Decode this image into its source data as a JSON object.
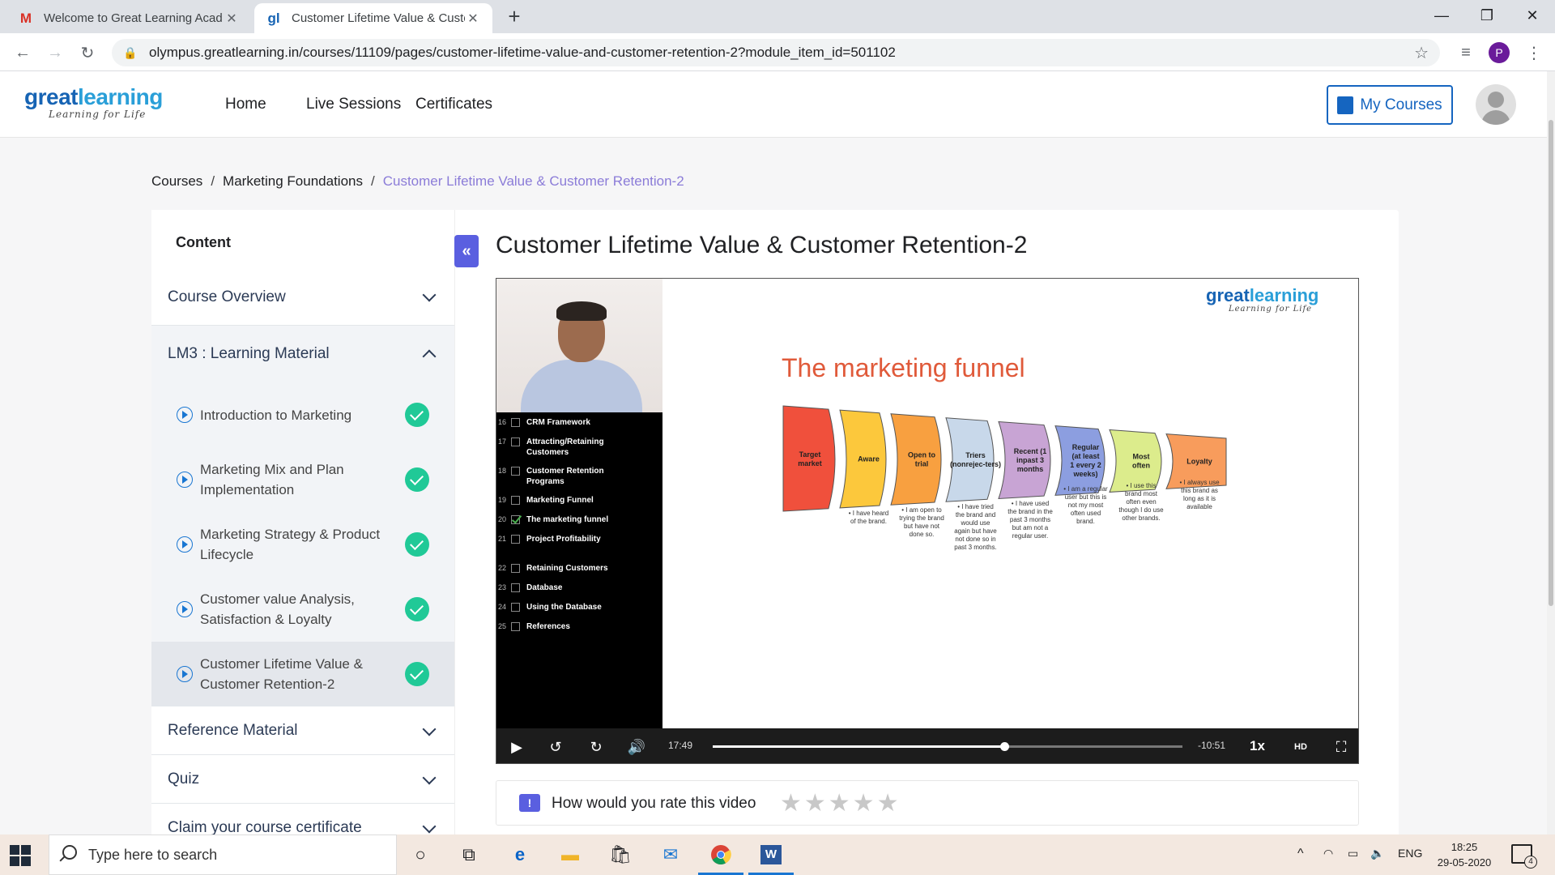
{
  "browser": {
    "tabs": [
      {
        "title": "Welcome to Great Learning Acad",
        "favicon": "gmail-icon"
      },
      {
        "title": "Customer Lifetime Value & Custo",
        "favicon": "greatlearning-icon"
      }
    ],
    "url": "olympus.greatlearning.in/courses/11109/pages/customer-lifetime-value-and-customer-retention-2?module_item_id=501102",
    "profile_initial": "P"
  },
  "header": {
    "logo_main": "great",
    "logo_accent": "learning",
    "logo_tagline": "Learning for Life",
    "nav": [
      "Home",
      "Live Sessions",
      "Certificates"
    ],
    "my_courses_label": "My Courses"
  },
  "breadcrumb": {
    "items": [
      "Courses",
      "Marketing Foundations"
    ],
    "current": "Customer Lifetime Value & Customer Retention-2",
    "separator": "/"
  },
  "sidebar": {
    "title": "Content",
    "sections": [
      {
        "label": "Course Overview"
      },
      {
        "label": "LM3 : Learning Material"
      },
      {
        "label": "Reference Material"
      },
      {
        "label": "Quiz"
      },
      {
        "label": "Claim your course certificate"
      }
    ],
    "items": [
      {
        "label": "Introduction to Marketing",
        "completed": true
      },
      {
        "label": "Marketing Mix and Plan Implementation",
        "completed": true
      },
      {
        "label": "Marketing Strategy & Product Lifecycle",
        "completed": true
      },
      {
        "label": "Customer value Analysis, Satisfaction & Loyalty",
        "completed": true
      },
      {
        "label": "Customer Lifetime Value & Customer Retention-2",
        "completed": true
      }
    ]
  },
  "page_title": "Customer Lifetime Value & Customer Retention-2",
  "video": {
    "toc": [
      {
        "num": "16",
        "label": "CRM Framework",
        "checked": false
      },
      {
        "num": "17",
        "label": "Attracting/Retaining Customers",
        "checked": false
      },
      {
        "num": "18",
        "label": "Customer Retention Programs",
        "checked": false
      },
      {
        "num": "19",
        "label": "Marketing Funnel",
        "checked": false
      },
      {
        "num": "20",
        "label": "The marketing funnel",
        "checked": true
      },
      {
        "num": "21",
        "label": "Project Profitability",
        "checked": false
      },
      {
        "num": "22",
        "label": "Retaining Customers",
        "checked": false
      },
      {
        "num": "23",
        "label": "Database",
        "checked": false
      },
      {
        "num": "24",
        "label": "Using the Database",
        "checked": false
      },
      {
        "num": "25",
        "label": "References",
        "checked": false
      }
    ],
    "slide_logo_main": "great",
    "slide_logo_accent": "learning",
    "slide_logo_tagline": "Learning for Life",
    "slide_title": "The marketing funnel",
    "funnel_stages": [
      {
        "label": "Target market",
        "color": "#f0503c",
        "note": ""
      },
      {
        "label": "Aware",
        "color": "#fcc83c",
        "note": "• I have heard of the brand."
      },
      {
        "label": "Open to trial",
        "color": "#f8a040",
        "note": "• I am open to trying the brand but have not done so."
      },
      {
        "label": "Triers (nonrejec-ters)",
        "color": "#c8d8ea",
        "note": "• I have tried the brand and would use again but have not done so in past 3 months."
      },
      {
        "label": "Recent (1 inpast 3 months",
        "color": "#c8a4d4",
        "note": "• I have used the brand in the past 3 months but am not a regular user."
      },
      {
        "label": "Regular (at least 1 every 2 weeks)",
        "color": "#8c9ee0",
        "note": "• I am a regular user but this is not my most often used brand."
      },
      {
        "label": "Most often",
        "color": "#dcec8c",
        "note": "• I use this brand most often even though I do use other brands."
      },
      {
        "label": "Loyalty",
        "color": "#f89c5c",
        "note": "• I always use this brand as long as it is available"
      }
    ],
    "elapsed": "17:49",
    "remaining": "-10:51",
    "progress_fraction": 0.62,
    "speed": "1x"
  },
  "rating": {
    "question": "How would you rate this video",
    "stars": "★★★★★"
  },
  "taskbar": {
    "search_placeholder": "Type here to search",
    "lang": "ENG",
    "time": "18:25",
    "date": "29-05-2020",
    "notifications": "4"
  }
}
